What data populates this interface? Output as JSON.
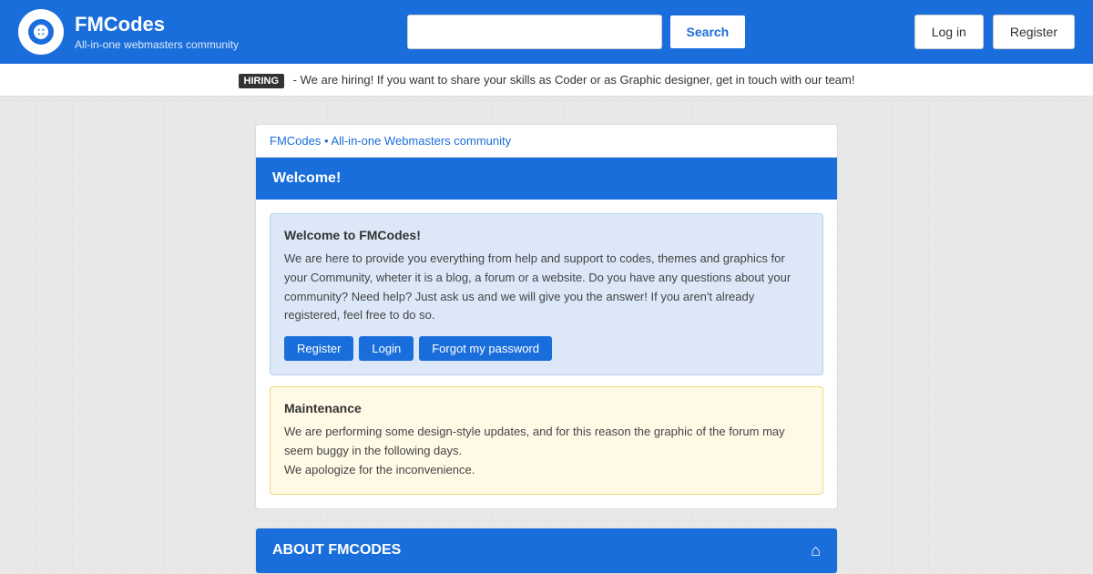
{
  "header": {
    "site_name": "FMCodes",
    "site_tagline": "All-in-one webmasters community",
    "search_placeholder": "",
    "search_button": "Search",
    "login_button": "Log in",
    "register_button": "Register"
  },
  "hiring_bar": {
    "badge": "HIRING",
    "message": " - We are hiring! If you want to share your skills as Coder or as Graphic designer, get in touch with our team!"
  },
  "breadcrumb": {
    "text": "FMCodes • All-in-one Webmasters community"
  },
  "welcome_section": {
    "header": "Welcome!",
    "welcome_box": {
      "title": "Welcome to FMCodes!",
      "body": "We are here to provide you everything from help and support to codes, themes and graphics for your Community, wheter it is a blog, a forum or a website. Do you have any questions about your community? Need help? Just ask us and we will give you the answer! If you aren't already registered, feel free to do so.",
      "register_btn": "Register",
      "login_btn": "Login",
      "forgot_btn": "Forgot my password"
    },
    "maintenance_box": {
      "title": "Maintenance",
      "line1": "We are performing some design-style updates, and for this reason the graphic of the forum may seem buggy in the following days.",
      "line2": "We apologize for the inconvenience."
    }
  },
  "about_section": {
    "header": "ABOUT FMCODES"
  }
}
